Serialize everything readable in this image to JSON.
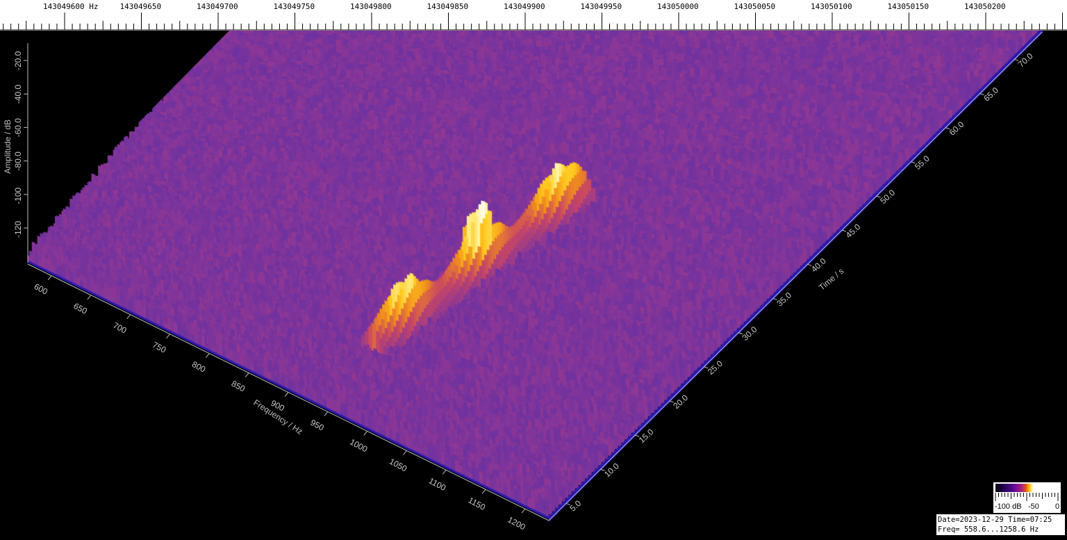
{
  "ruler": {
    "labels": [
      "143049600 Hz",
      "143049650",
      "143049700",
      "143049750",
      "143049800",
      "143049850",
      "143049900",
      "143049950",
      "143050000",
      "143050050",
      "143050100",
      "143050150",
      "143050200"
    ]
  },
  "axes": {
    "amplitude_label": "Amplitude / dB",
    "amplitude_ticks": [
      "-20.0",
      "-40.0",
      "-60.0",
      "-80.0",
      "-100",
      "-120"
    ],
    "frequency_label": "Frequency / Hz",
    "frequency_ticks": [
      "600",
      "650",
      "700",
      "750",
      "800",
      "850",
      "900",
      "950",
      "1000",
      "1050",
      "1100",
      "1150",
      "1200"
    ],
    "time_label": "Time / s",
    "time_ticks": [
      "5.0",
      "10.0",
      "15.0",
      "20.0",
      "25.0",
      "30.0",
      "35.0",
      "40.0",
      "45.0",
      "50.0",
      "55.0",
      "60.0",
      "65.0",
      "70.0"
    ]
  },
  "colorbar": {
    "label_low": "-100 dB",
    "label_mid": "-50",
    "label_high": "0"
  },
  "info": {
    "date_line": "Date=2023-12-29 Time=07:25",
    "freq_line": "Freq= 558.6...1258.6 Hz"
  },
  "colors": {
    "background": "#000000",
    "noise": "#6a3aa0",
    "signal_peak": "#ffd040",
    "peak_hot": "#ffffff"
  }
}
